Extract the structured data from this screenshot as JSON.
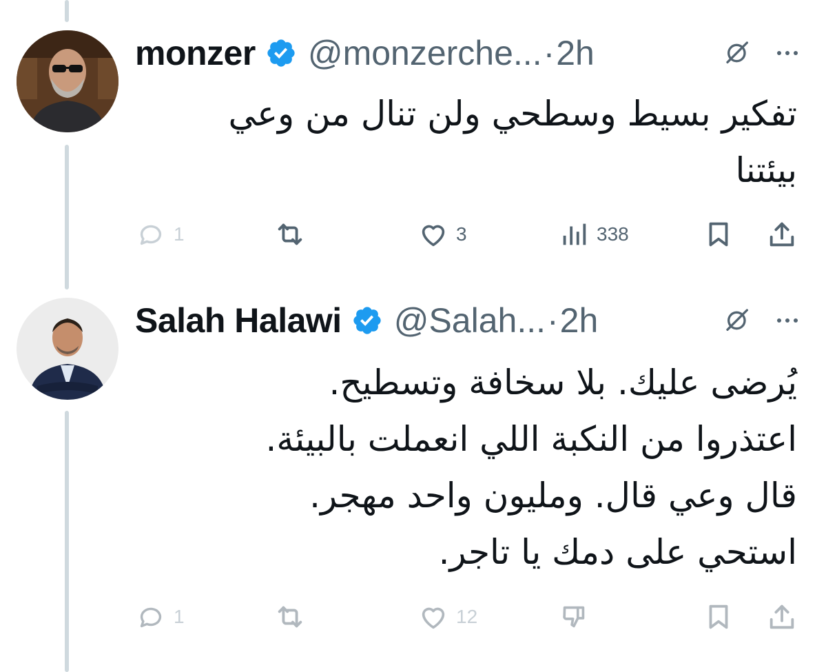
{
  "tweets": [
    {
      "display_name": "monzer",
      "handle": "@monzerche...",
      "separator": "·",
      "time": "2h",
      "verified": true,
      "text_lines": [
        "تفكير بسيط وسطحي ولن تنال من وعي",
        "بيئتنا"
      ],
      "actions": {
        "reply_count": "1",
        "retweet_count": "",
        "like_count": "3",
        "views_count": "338"
      },
      "icons": [
        "reply-icon",
        "retweet-icon",
        "like-icon",
        "views-icon",
        "bookmark-icon",
        "share-icon"
      ]
    },
    {
      "display_name": "Salah Halawi",
      "handle": "@Salah...",
      "separator": "·",
      "time": "2h",
      "verified": true,
      "text_lines": [
        "يُرضى عليك. بلا سخافة وتسطيح.",
        "اعتذروا من النكبة اللي انعملت بالبيئة.",
        "قال وعي قال. ومليون واحد مهجر.",
        "استحي على دمك يا تاجر."
      ],
      "actions": {
        "reply_count": "1",
        "retweet_count": "",
        "like_count": "12"
      },
      "icons": [
        "reply-icon",
        "retweet-icon",
        "like-icon",
        "downvote-icon",
        "bookmark-icon",
        "share-icon"
      ]
    }
  ],
  "colors": {
    "verified_badge": "#1d9bf0",
    "secondary_text": "#536471",
    "thread_line": "#cfd9de",
    "muted_actions": "#c8d0d6"
  }
}
